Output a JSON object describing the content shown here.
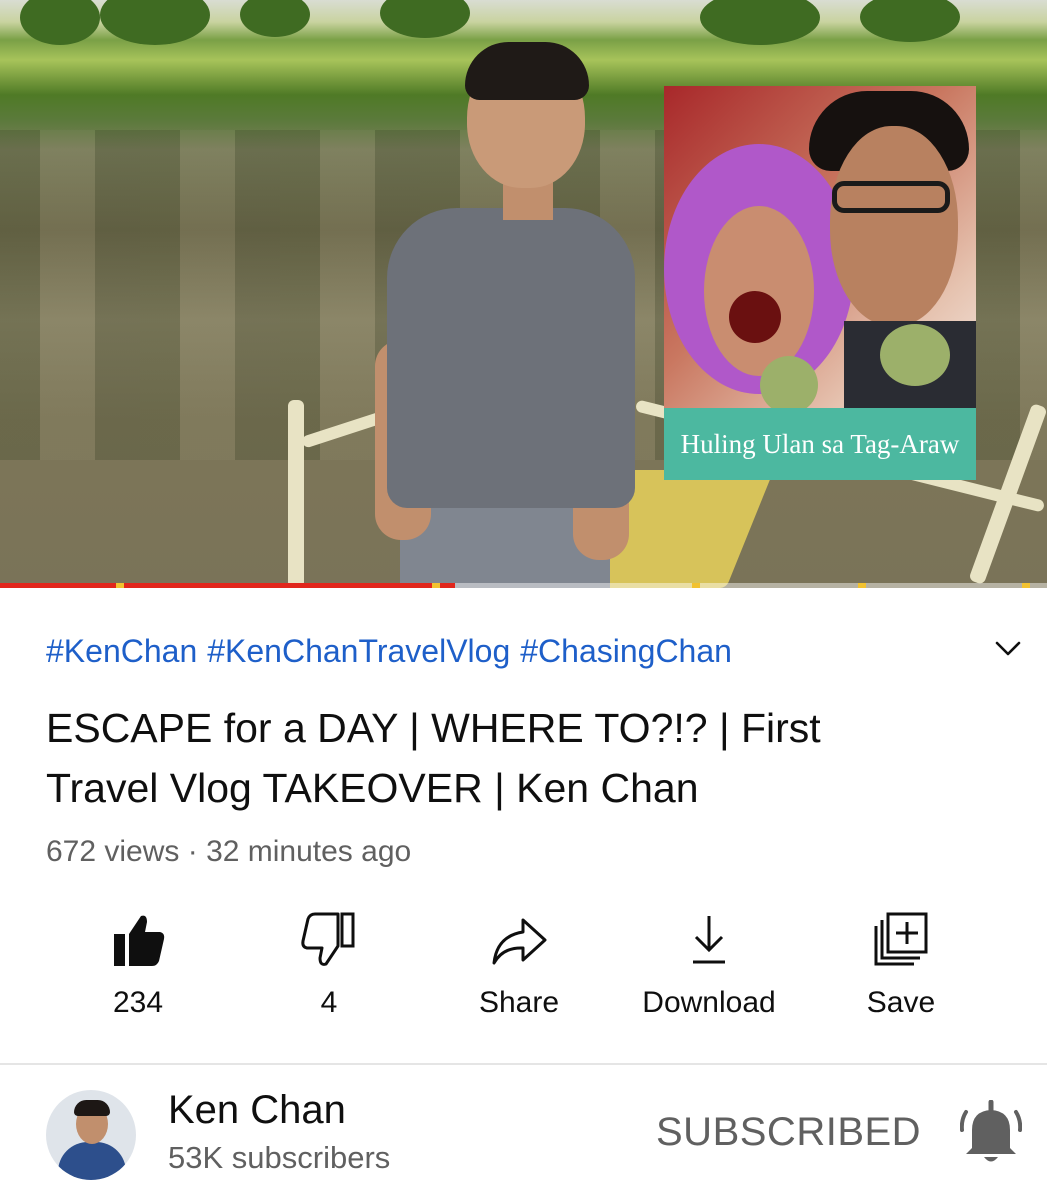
{
  "video": {
    "poster_title": "Huling Ulan sa Tag-Araw",
    "progress_fraction": 0.435,
    "colors": {
      "progress": "#e1261c",
      "ad_marker": "#f2c230"
    }
  },
  "hashtags": [
    "#KenChan",
    "#KenChanTravelVlog",
    "#ChasingChan"
  ],
  "title": "ESCAPE for a DAY | WHERE TO?!? | First Travel Vlog TAKEOVER | Ken Chan",
  "meta": "672 views · 32 minutes ago",
  "actions": [
    {
      "icon": "thumbs-up-filled-icon",
      "label": "234"
    },
    {
      "icon": "thumbs-down-icon",
      "label": "4"
    },
    {
      "icon": "share-icon",
      "label": "Share"
    },
    {
      "icon": "download-icon",
      "label": "Download"
    },
    {
      "icon": "save-to-playlist-icon",
      "label": "Save"
    }
  ],
  "channel": {
    "name": "Ken Chan",
    "subscribers": "53K subscribers",
    "subscribe_state": "SUBSCRIBED"
  },
  "colors": {
    "link": "#1e5fc9",
    "secondary_text": "#606060"
  }
}
